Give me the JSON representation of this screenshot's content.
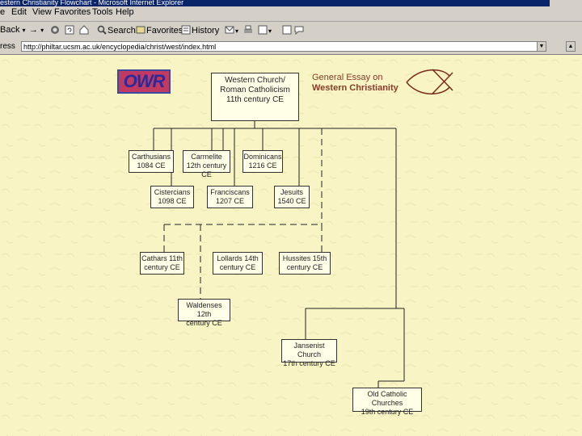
{
  "window": {
    "title": "estern Christianity Flowchart - Microsoft Internet Explorer"
  },
  "menu": [
    "e",
    "Edit",
    "View",
    "Favorites",
    "Tools",
    "Help"
  ],
  "toolbar": {
    "back": "Back",
    "forward_icon": "arrow-right-icon",
    "search": "Search",
    "favorites": "Favorites",
    "history": "History"
  },
  "address": {
    "label": "ress",
    "url": "http://philtar.ucsm.ac.uk/encyclopedia/christ/west/index.html"
  },
  "logo": {
    "text": "OWR"
  },
  "essay_link": {
    "line1": "General Essay on",
    "line2": "Western Christianity"
  },
  "nodes": {
    "root": {
      "line1": "Western Church/",
      "line2": "Roman Catholicism",
      "line3": "11th century CE"
    },
    "carthusians": {
      "line1": "Carthusians",
      "line2": "1084 CE"
    },
    "carmelite": {
      "line1": "Carmelite",
      "line2": "12th century CE"
    },
    "dominicans": {
      "line1": "Dominicans",
      "line2": "1216 CE"
    },
    "cistercians": {
      "line1": "Cistercians",
      "line2": "1098 CE"
    },
    "franciscans": {
      "line1": "Franciscans",
      "line2": "1207 CE"
    },
    "jesuits": {
      "line1": "Jesuits",
      "line2": "1540 CE"
    },
    "cathars": {
      "line1": "Cathars 11th",
      "line2": "century CE"
    },
    "lollards": {
      "line1": "Lollards 14th",
      "line2": "century CE"
    },
    "hussites": {
      "line1": "Hussites 15th",
      "line2": "century CE"
    },
    "waldenses": {
      "line1": "Waldenses 12th",
      "line2": "century CE"
    },
    "jansenist": {
      "line1": "Jansenist Church",
      "line2": "17th century CE"
    },
    "oldcatholic": {
      "line1": "Old Catholic Churches",
      "line2": "19th century CE"
    }
  },
  "colors": {
    "page_bg": "#f8f4c4",
    "chrome": "#d4d0c8",
    "title_bar": "#0a246a",
    "logo_bg": "#c03a62",
    "link_text": "#8a3a2a"
  }
}
